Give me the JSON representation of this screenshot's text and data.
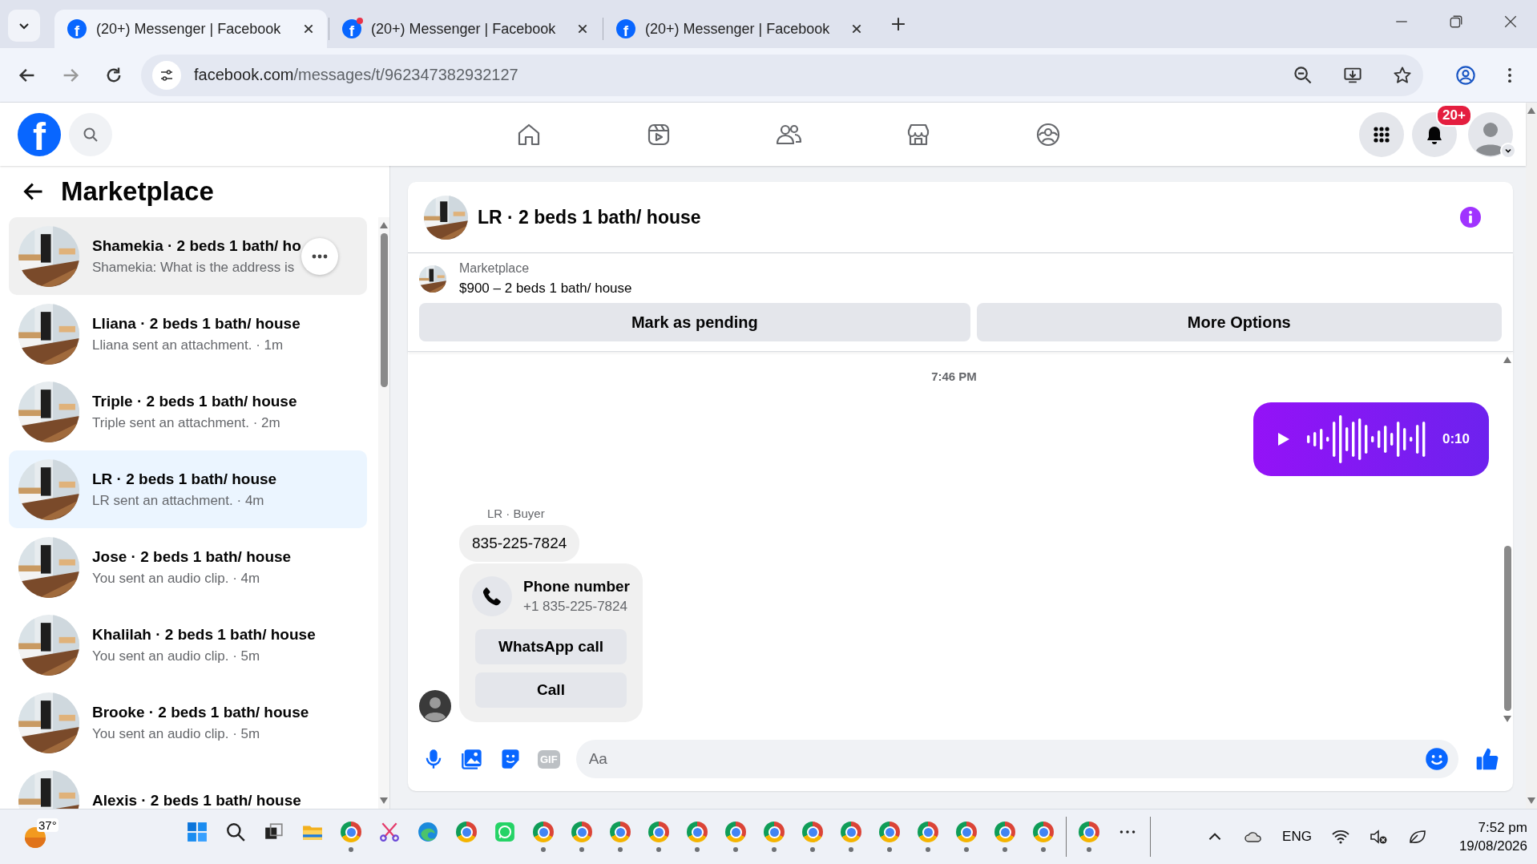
{
  "browser": {
    "tabs": [
      {
        "title": "(20+) Messenger | Facebook",
        "favicon_letter": "f",
        "selected": true,
        "unread_dot": false
      },
      {
        "title": "(20+) Messenger | Facebook",
        "favicon_letter": "f",
        "selected": false,
        "unread_dot": true
      },
      {
        "title": "(20+) Messenger | Facebook",
        "favicon_letter": "f",
        "selected": false,
        "unread_dot": false
      }
    ],
    "url_domain": "facebook.com",
    "url_path": "/messages/t/962347382932127"
  },
  "topnav": {
    "logo_letter": "f",
    "items": [
      {
        "kind": "home"
      },
      {
        "kind": "video"
      },
      {
        "kind": "friends"
      },
      {
        "kind": "marketplace"
      },
      {
        "kind": "groups"
      }
    ],
    "notification_badge": "20+"
  },
  "sidebar": {
    "title": "Marketplace",
    "conversations": [
      {
        "title": "Shamekia · 2 beds 1 bath/ ho",
        "preview": "Shamekia: What is the address is",
        "selected": false,
        "hovered": true
      },
      {
        "title": "Lliana · 2 beds 1 bath/ house",
        "preview": "Lliana sent an attachment. · 1m",
        "selected": false,
        "hovered": false
      },
      {
        "title": "Triple · 2 beds 1 bath/ house",
        "preview": "Triple sent an attachment. · 2m",
        "selected": false,
        "hovered": false
      },
      {
        "title": "LR · 2 beds 1 bath/ house",
        "preview": "LR sent an attachment. · 4m",
        "selected": true,
        "hovered": false
      },
      {
        "title": "Jose · 2 beds 1 bath/ house",
        "preview": "You sent an audio clip. · 4m",
        "selected": false,
        "hovered": false
      },
      {
        "title": "Khalilah · 2 beds 1 bath/ house",
        "preview": "You sent an audio clip. · 5m",
        "selected": false,
        "hovered": false
      },
      {
        "title": "Brooke · 2 beds 1 bath/ house",
        "preview": "You sent an audio clip. · 5m",
        "selected": false,
        "hovered": false
      },
      {
        "title": "Alexis · 2 beds 1 bath/ house",
        "selected": false,
        "hovered": false
      }
    ]
  },
  "chat": {
    "title": "LR · 2 beds 1 bath/ house",
    "listing": {
      "label": "Marketplace",
      "title": "$900 – 2 beds 1 bath/ house"
    },
    "actions": [
      "Mark as pending",
      "More Options"
    ],
    "messages": [
      {
        "kind": "timestamp",
        "text": "7:46 PM"
      },
      {
        "kind": "audio",
        "duration": "0:10"
      },
      {
        "kind": "incoming_group",
        "sender": "LR · Buyer",
        "items": [
          {
            "kind": "text",
            "text": "835-225-7824"
          },
          {
            "kind": "phone_card",
            "title": "Phone number",
            "number": "+1 835-225-7824",
            "buttons": [
              "WhatsApp call",
              "Call"
            ]
          }
        ]
      }
    ],
    "composer": {
      "placeholder": "Aa",
      "gif_label": "GIF"
    }
  },
  "taskbar": {
    "weather": "37°",
    "apps": [
      {
        "kind": "start",
        "running": false
      },
      {
        "kind": "search",
        "running": false
      },
      {
        "kind": "taskview",
        "running": false
      },
      {
        "kind": "folder",
        "running": false
      },
      {
        "kind": "chrome",
        "running": true
      },
      {
        "kind": "snip",
        "running": false
      },
      {
        "kind": "edge",
        "running": false
      },
      {
        "kind": "chrome",
        "running": false
      },
      {
        "kind": "whatsapp",
        "running": false
      },
      {
        "kind": "chrome",
        "running": true
      },
      {
        "kind": "chrome",
        "running": true
      },
      {
        "kind": "chrome",
        "running": true
      },
      {
        "kind": "chrome",
        "running": true
      },
      {
        "kind": "chrome",
        "running": true
      },
      {
        "kind": "chrome",
        "running": true
      },
      {
        "kind": "chrome",
        "running": true
      },
      {
        "kind": "chrome",
        "running": true
      },
      {
        "kind": "chrome",
        "running": true
      },
      {
        "kind": "chrome",
        "running": true
      },
      {
        "kind": "chrome",
        "running": true
      },
      {
        "kind": "chrome",
        "running": true
      },
      {
        "kind": "chrome",
        "running": true
      },
      {
        "kind": "chrome",
        "running": true
      },
      {
        "kind": "separator"
      },
      {
        "kind": "chrome",
        "running": true
      },
      {
        "kind": "more",
        "running": false
      }
    ],
    "language": "ENG",
    "time": "7:52 pm",
    "date": "19/08/2026"
  }
}
